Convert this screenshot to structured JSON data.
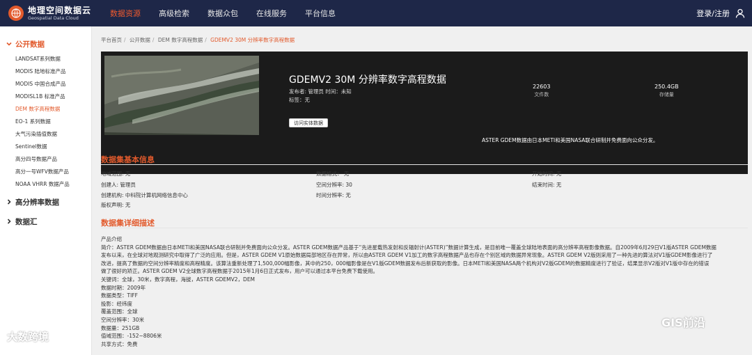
{
  "nav": {
    "logo_cn": "地理空间数据云",
    "logo_en": "Geospatial Data Cloud",
    "items": [
      {
        "label": "数据资源",
        "active": true
      },
      {
        "label": "高级检索",
        "active": false
      },
      {
        "label": "数据众包",
        "active": false
      },
      {
        "label": "在线服务",
        "active": false
      },
      {
        "label": "平台信息",
        "active": false
      }
    ],
    "login": "登录/注册"
  },
  "sidebar": {
    "sections": [
      {
        "title": "公开数据",
        "active": true,
        "items": [
          {
            "label": "LANDSAT系列数据",
            "active": false
          },
          {
            "label": "MODIS 陆地标准产品",
            "active": false
          },
          {
            "label": "MODIS 中国合成产品",
            "active": false
          },
          {
            "label": "MODISL1B 标准产品",
            "active": false
          },
          {
            "label": "DEM 数字高程数据",
            "active": true
          },
          {
            "label": "EO-1 系列数据",
            "active": false
          },
          {
            "label": "大气污染插值数据",
            "active": false
          },
          {
            "label": "Sentinel数据",
            "active": false
          },
          {
            "label": "高分四号数据产品",
            "active": false
          },
          {
            "label": "高分一号WFV数据产品",
            "active": false
          },
          {
            "label": "NOAA VHRR 数据产品",
            "active": false
          }
        ]
      },
      {
        "title": "高分辨率数据",
        "active": false,
        "items": []
      },
      {
        "title": "数据汇",
        "active": false,
        "items": []
      }
    ]
  },
  "breadcrumb": [
    "平台首页",
    "公开数据",
    "DEM 数字高程数据",
    "GDEMV2 30M 分辨率数字高程数据"
  ],
  "dataset": {
    "title": "GDEMV2 30M 分辨率数字高程数据",
    "publish": "发布者: 管理员 时间：未知",
    "tags": "标签：无",
    "visit_button": "访问实体数据",
    "files_count": "22603",
    "files_label": "文件数",
    "storage": "250.4GB",
    "storage_label": "存储量",
    "summary": "ASTER GDEM数据由日本METI和美国NASA联合研制并免费面向公众分发。"
  },
  "basic_info": {
    "title": "数据集基本信息",
    "col1": [
      "地域范围: 无",
      "创建人: 管理员",
      "创建机构: 中科院计算机网络信息中心",
      "版权声明: 无"
    ],
    "col2": [
      "数据格式： 无",
      "空间分辨率: 30",
      "时间分辨率: 无"
    ],
    "col3": [
      "开始时间: 无",
      "结束时间: 无"
    ]
  },
  "detail": {
    "title": "数据集详细描述",
    "lines": [
      "产品介绍",
      "简介：ASTER GDEM数据由日本METI和美国NASA联合研制并免费面向公众分发。ASTER GDEM数据产品基于“先进星载热发射和反辐射计(ASTER)”数据计算生成，是目前唯一覆盖全球陆地表面的高分辨率高程影像数据。自2009年6月29日V1版ASTER GDEM数据",
      "发布以来，在全球对地观测研究中取得了广泛的应用。但是，ASTER GDEM V1原始数据局部地区存在异常，所以由ASTER GDEM V1加工的数字高程数据产品也存在个别区域的数据异常现象。ASTER GDEM V2版则采用了一种先进的算法对V1版GDEM影像进行了",
      "改进，提高了数据的空间分辨率精度和高程精度。该算法重新处理了1,500,000幅影像，其中的250，000幅影像是在V1版GDEM数据发布后新获取的影像。日本METI和美国NASA两个机构对V2版GDEM的数据精度进行了验证，结果显示V2版对V1版中存在的错误",
      "做了很好的矫正。ASTER GDEM V2全球数字高程数据于2015年1月6日正式发布，用户可以通过本平台免费下载使用。",
      "关键词：全球，30米，数字高程，海拔，ASTER GDEMV2，DEM",
      "数据时期：2009年",
      "数据类型：TIFF",
      "投影：经纬度",
      "覆盖范围：全球",
      "空间分辨率：30米",
      "数据量：251GB",
      "值域范围：-152~8806米",
      "共享方式：免费"
    ]
  },
  "watermarks": [
    "GIS前沿",
    "大数跨境"
  ],
  "colors": {
    "nav_bg": "#1e2748",
    "accent": "#e25a2c",
    "banner_bg": "#1b1b1b"
  }
}
